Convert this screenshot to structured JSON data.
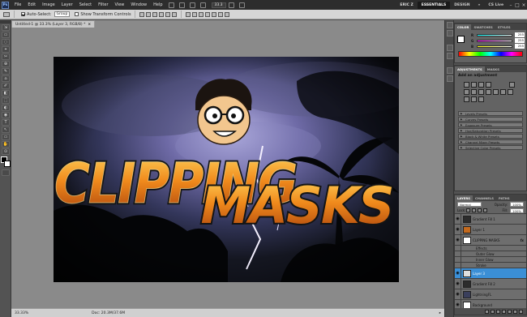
{
  "menubar": {
    "logo": "Ps",
    "items": [
      "File",
      "Edit",
      "Image",
      "Layer",
      "Select",
      "Filter",
      "View",
      "Window",
      "Help"
    ],
    "zoom": "33.3",
    "user": "ERIC Z",
    "workspaces": {
      "active": "ESSENTIALS",
      "other": "DESIGN",
      "more": "»"
    },
    "cs_live": "CS Live",
    "controls": {
      "minimize": "–",
      "restore": "□",
      "close": "×"
    }
  },
  "options": {
    "auto_select_label": "Auto-Select:",
    "auto_select_value": "Group",
    "show_transform": "Show Transform Controls"
  },
  "tools": [
    "⇲",
    "▭",
    "◌",
    "⌖",
    "✂",
    "⊕",
    "✎",
    "⌂",
    "✐",
    "◧",
    "⬚",
    "◐",
    "◉",
    "T",
    "↖",
    "▭",
    "✋",
    "⊙"
  ],
  "document": {
    "tab_title": "Untitled-1 @ 33.3% (Layer 3, RGB/8) *",
    "close": "×",
    "artwork": {
      "line1": "CLIPPING",
      "line2": "MASKS"
    }
  },
  "status": {
    "zoom": "33.33%",
    "doc": "Doc: 20.3M/37.6M"
  },
  "color_panel": {
    "tabs": [
      "COLOR",
      "SWATCHES",
      "STYLES"
    ],
    "channels": [
      {
        "label": "R",
        "value": "255"
      },
      {
        "label": "G",
        "value": "255"
      },
      {
        "label": "B",
        "value": "255"
      }
    ]
  },
  "adjustments_panel": {
    "tabs": [
      "ADJUSTMENTS",
      "MASKS"
    ],
    "title": "Add an adjustment",
    "presets": [
      "Levels Presets",
      "Curves Presets",
      "Exposure Presets",
      "Hue/Saturation Presets",
      "Black & White Presets",
      "Channel Mixer Presets",
      "Selective Color Presets"
    ]
  },
  "layers_panel": {
    "tabs": [
      "LAYERS",
      "CHANNELS",
      "PATHS"
    ],
    "blend_mode": "Normal",
    "opacity_label": "Opacity:",
    "opacity": "100%",
    "lock_label": "Lock:",
    "fill_label": "Fill:",
    "fill": "100%",
    "layers": [
      {
        "name": "Gradient Fill 1",
        "fx": "",
        "selected": false,
        "thumb": "#2c2c2c",
        "sub": false
      },
      {
        "name": "Layer 1",
        "fx": "",
        "selected": false,
        "thumb": "#c46a1e",
        "sub": false
      },
      {
        "name": "CLIPPING MASKS",
        "fx": "fx",
        "selected": false,
        "thumb": "#ffffff",
        "sub": false
      },
      {
        "name": "Effects",
        "fx": "",
        "selected": false,
        "thumb": "",
        "sub": true
      },
      {
        "name": "Outer Glow",
        "fx": "",
        "selected": false,
        "thumb": "",
        "sub": true
      },
      {
        "name": "Inner Glow",
        "fx": "",
        "selected": false,
        "thumb": "",
        "sub": true
      },
      {
        "name": "Stroke",
        "fx": "",
        "selected": false,
        "thumb": "",
        "sub": true
      },
      {
        "name": "Layer 3",
        "fx": "",
        "selected": true,
        "thumb": "#dedede",
        "sub": false
      },
      {
        "name": "Gradient Fill 2",
        "fx": "",
        "selected": false,
        "thumb": "#2c2c2c",
        "sub": false
      },
      {
        "name": "LightningFL",
        "fx": "",
        "selected": false,
        "thumb": "#3a3f5c",
        "sub": false
      },
      {
        "name": "Background",
        "fx": "",
        "selected": false,
        "thumb": "#ffffff",
        "sub": false
      }
    ]
  },
  "colors": {
    "accent": "#3b8fd6",
    "chrome": "#535353",
    "letters_fill": "#e07a12",
    "letters_stroke": "#141414"
  }
}
